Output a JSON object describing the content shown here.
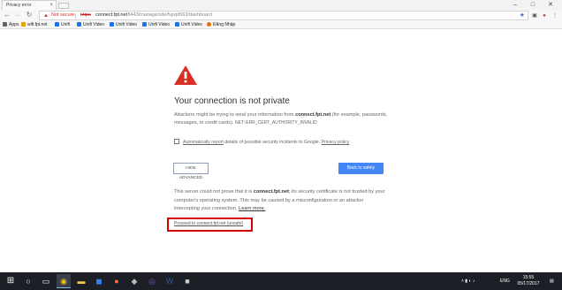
{
  "browser": {
    "tab_title": "Privacy error",
    "tab_close": "×",
    "window_controls": {
      "minimize": "–",
      "maximize": "□",
      "close": "✕"
    },
    "address": {
      "security_label": "Not secure",
      "scheme": "https",
      "host": "connect.fpt.net",
      "path": ":8443/manage/site/fvpqd563/dashboard"
    },
    "nav_icons": {
      "back": "←",
      "forward": "→",
      "reload": "↻"
    },
    "bookmarks": [
      {
        "label": "Apps",
        "color": "#5f6368"
      },
      {
        "label": "wifi.fpt.net",
        "color": "#e8a000"
      },
      {
        "label": "Unifi",
        "color": "#1a73e8"
      },
      {
        "label": "Unifi Video",
        "color": "#1a73e8"
      },
      {
        "label": "Unifi Video",
        "color": "#1a73e8"
      },
      {
        "label": "Unifi Video",
        "color": "#1a73e8"
      },
      {
        "label": "Unifi Video",
        "color": "#1a73e8"
      },
      {
        "label": "Đăng Nhập",
        "color": "#e8710a"
      }
    ]
  },
  "interstitial": {
    "heading": "Your connection is not private",
    "desc_prefix": "Attackers might be trying to steal your information from ",
    "desc_host": "connect.fpt.net",
    "desc_suffix": " (for example, passwords, messages, or credit cards). ",
    "error_code": "NET::ERR_CERT_AUTHORITY_INVALID",
    "report_link": "Automatically report",
    "report_text": " details of possible security incidents to Google. ",
    "privacy_link": "Privacy policy",
    "advanced_button": "HIDE ADVANCED",
    "safety_button": "Back to safety",
    "details_prefix": "This server could not prove that it is ",
    "details_host": "connect.fpt.net",
    "details_suffix": "; its security certificate is not trusted by your computer's operating system. This may be caused by a misconfiguration or an attacker intercepting your connection. ",
    "learn_more": "Learn more.",
    "proceed_link": "Proceed to connect.fpt.net (unsafe)"
  },
  "taskbar": {
    "language": "ENG",
    "time": "15:55",
    "date": "05/17/2017",
    "accent_color": "#76b9ed"
  }
}
